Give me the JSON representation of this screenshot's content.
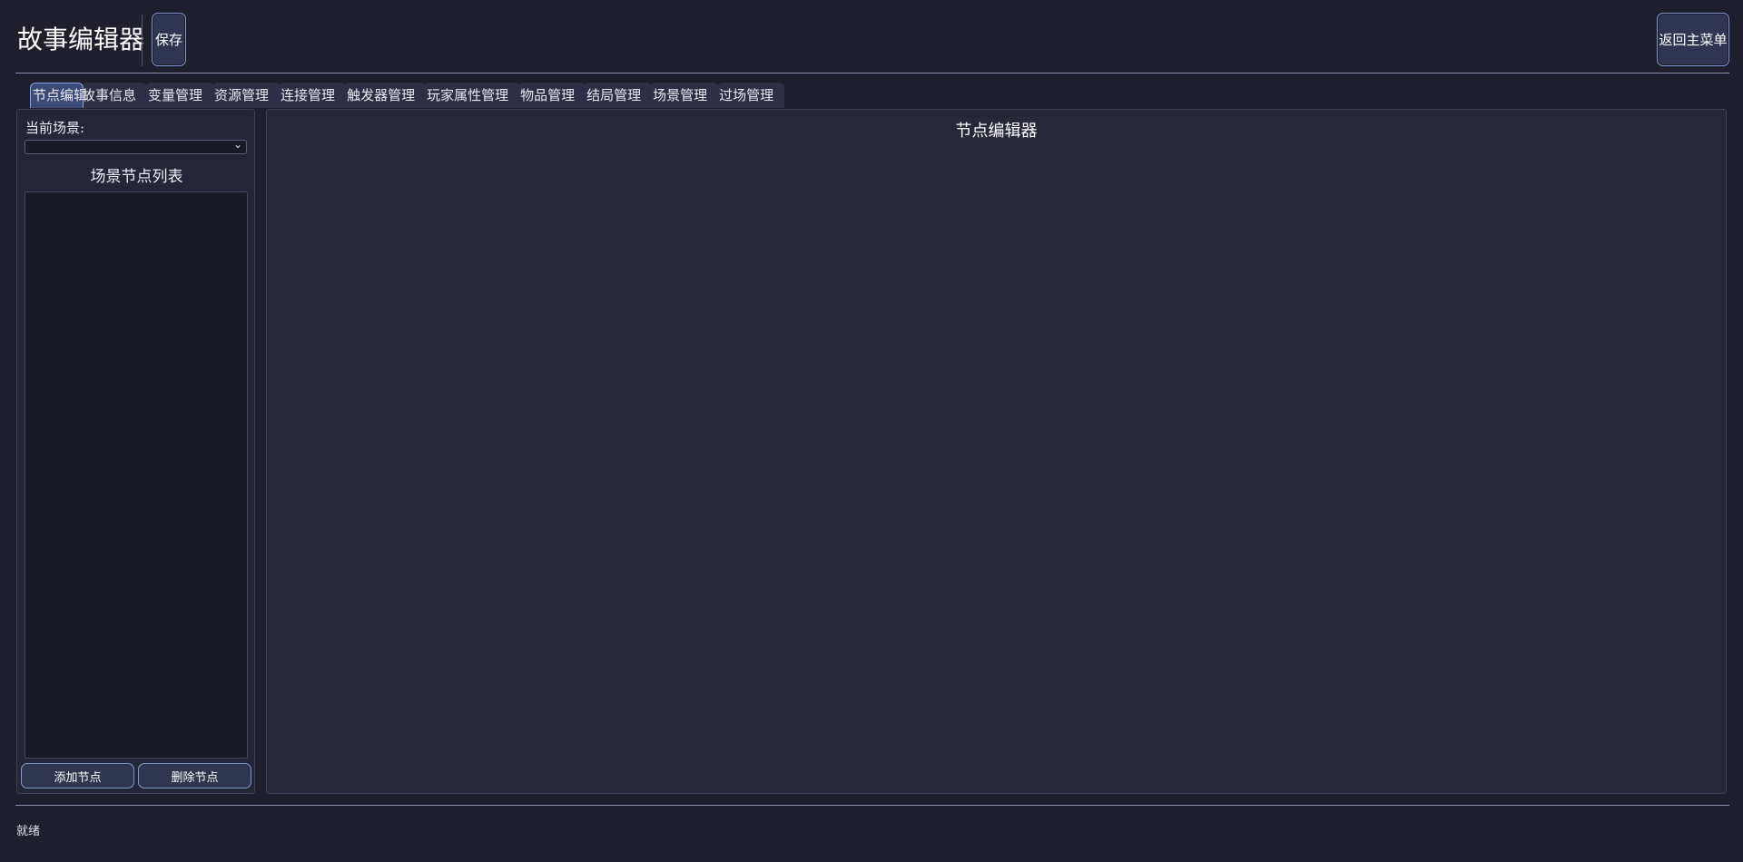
{
  "header": {
    "title": "故事编辑器",
    "save_label": "保存",
    "back_label": "返回主菜单"
  },
  "tabs": [
    {
      "label": "节点编辑",
      "active": true
    },
    {
      "label": "故事信息"
    },
    {
      "label": "变量管理"
    },
    {
      "label": "资源管理"
    },
    {
      "label": "连接管理"
    },
    {
      "label": "触发器管理"
    },
    {
      "label": "玩家属性管理"
    },
    {
      "label": "物品管理"
    },
    {
      "label": "结局管理"
    },
    {
      "label": "场景管理"
    },
    {
      "label": "过场管理"
    }
  ],
  "left_panel": {
    "scene_label": "当前场景:",
    "scene_value": "",
    "node_list_title": "场景节点列表",
    "add_node_label": "添加节点",
    "delete_node_label": "删除节点"
  },
  "editor": {
    "title": "节点编辑器"
  },
  "status": {
    "text": "就绪"
  },
  "colors": {
    "background": "#1e1e2d",
    "panel": "#242536",
    "canvas": "#27273a",
    "accent_border": "#7f97cf",
    "button_bg": "#2f3552"
  }
}
